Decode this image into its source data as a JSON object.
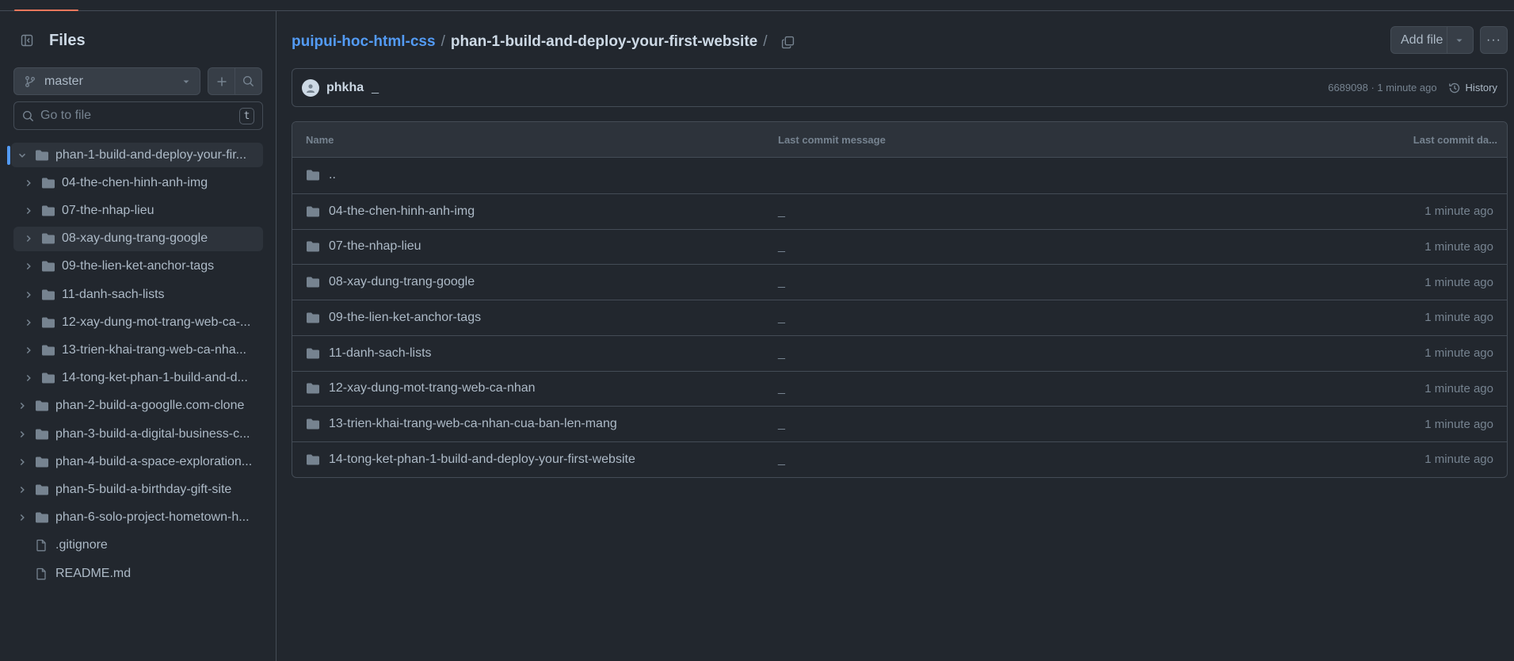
{
  "sidebar": {
    "title": "Files",
    "branch": "master",
    "goto_placeholder": "Go to file",
    "goto_shortcut": "t",
    "tree": [
      {
        "name": "phan-1-build-and-deploy-your-fir...",
        "type": "folder",
        "level": 0,
        "expanded": true,
        "active": true
      },
      {
        "name": "04-the-chen-hinh-anh-img",
        "type": "folder",
        "level": 1
      },
      {
        "name": "07-the-nhap-lieu",
        "type": "folder",
        "level": 1
      },
      {
        "name": "08-xay-dung-trang-google",
        "type": "folder",
        "level": 1,
        "hover": true
      },
      {
        "name": "09-the-lien-ket-anchor-tags",
        "type": "folder",
        "level": 1
      },
      {
        "name": "11-danh-sach-lists",
        "type": "folder",
        "level": 1
      },
      {
        "name": "12-xay-dung-mot-trang-web-ca-...",
        "type": "folder",
        "level": 1
      },
      {
        "name": "13-trien-khai-trang-web-ca-nha...",
        "type": "folder",
        "level": 1
      },
      {
        "name": "14-tong-ket-phan-1-build-and-d...",
        "type": "folder",
        "level": 1
      },
      {
        "name": "phan-2-build-a-googlle.com-clone",
        "type": "folder",
        "level": 0
      },
      {
        "name": "phan-3-build-a-digital-business-c...",
        "type": "folder",
        "level": 0
      },
      {
        "name": "phan-4-build-a-space-exploration...",
        "type": "folder",
        "level": 0
      },
      {
        "name": "phan-5-build-a-birthday-gift-site",
        "type": "folder",
        "level": 0
      },
      {
        "name": "phan-6-solo-project-hometown-h...",
        "type": "folder",
        "level": 0
      },
      {
        "name": ".gitignore",
        "type": "file",
        "level": 0
      },
      {
        "name": "README.md",
        "type": "file",
        "level": 0
      }
    ]
  },
  "breadcrumb": {
    "repo": "puipui-hoc-html-css",
    "separator": "/",
    "current": "phan-1-build-and-deploy-your-first-website",
    "trailing": "/"
  },
  "actions": {
    "add_file": "Add file",
    "more": "···"
  },
  "commit": {
    "author": "phkha",
    "message": "_",
    "sha_time": "6689098 · 1 minute ago",
    "history": "History"
  },
  "table": {
    "headers": {
      "name": "Name",
      "message": "Last commit message",
      "date": "Last commit da..."
    },
    "rows": [
      {
        "name": "..",
        "message": "",
        "date": ""
      },
      {
        "name": "04-the-chen-hinh-anh-img",
        "message": "_",
        "date": "1 minute ago"
      },
      {
        "name": "07-the-nhap-lieu",
        "message": "_",
        "date": "1 minute ago"
      },
      {
        "name": "08-xay-dung-trang-google",
        "message": "_",
        "date": "1 minute ago"
      },
      {
        "name": "09-the-lien-ket-anchor-tags",
        "message": "_",
        "date": "1 minute ago"
      },
      {
        "name": "11-danh-sach-lists",
        "message": "_",
        "date": "1 minute ago"
      },
      {
        "name": "12-xay-dung-mot-trang-web-ca-nhan",
        "message": "_",
        "date": "1 minute ago"
      },
      {
        "name": "13-trien-khai-trang-web-ca-nhan-cua-ban-len-mang",
        "message": "_",
        "date": "1 minute ago"
      },
      {
        "name": "14-tong-ket-phan-1-build-and-deploy-your-first-website",
        "message": "_",
        "date": "1 minute ago"
      }
    ]
  },
  "colors": {
    "background": "#22272e",
    "link": "#539bf5",
    "accent": "#ec775c",
    "folder": "#768390"
  }
}
